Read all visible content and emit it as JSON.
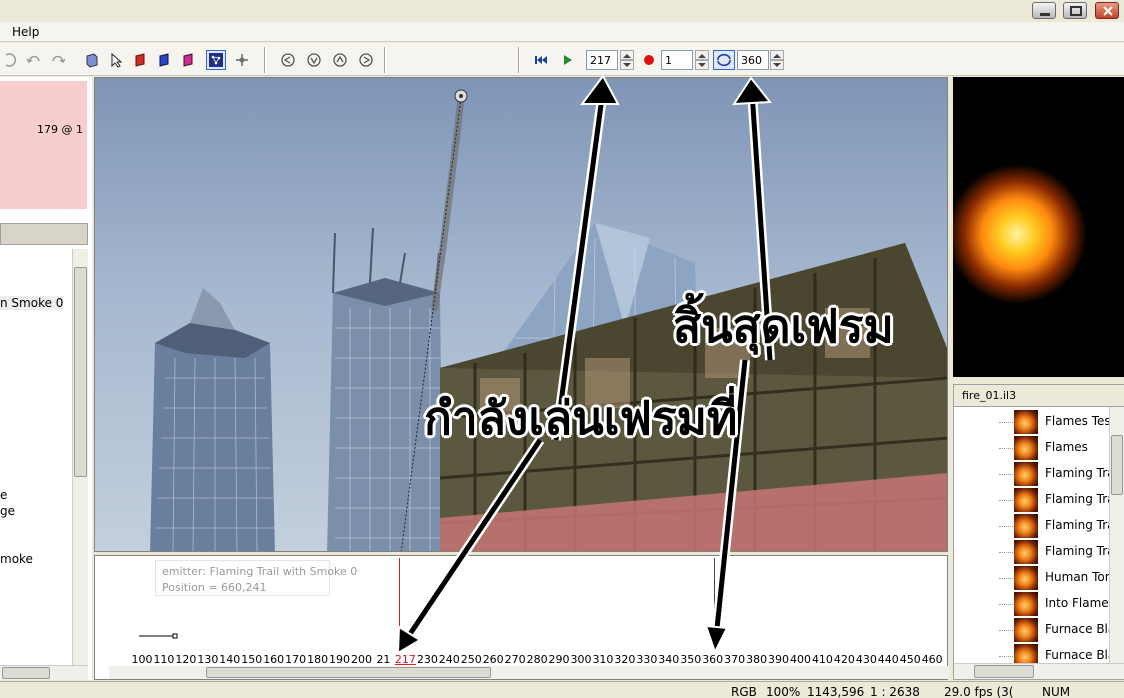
{
  "menu": {
    "help_label": "Help"
  },
  "toolbar": {
    "current_frame": "217",
    "frame_step": "1",
    "end_frame": "360"
  },
  "left_panel": {
    "pink_label": "179 @ 1",
    "items": [
      "n Smoke 0",
      "e",
      "ge",
      "moke"
    ]
  },
  "timeline": {
    "info_line1": "emitter:  Flaming Trail with Smoke 0",
    "info_line2": "Position = 660,241",
    "ticks": [
      "100",
      "110",
      "120",
      "130",
      "140",
      "150",
      "160",
      "170",
      "180",
      "190",
      "200",
      "21",
      "217",
      "230",
      "240",
      "250",
      "260",
      "270",
      "280",
      "290",
      "300",
      "310",
      "320",
      "330",
      "340",
      "350",
      "360",
      "370",
      "380",
      "390",
      "400",
      "410",
      "420",
      "430",
      "440",
      "450",
      "460"
    ],
    "current_tick": "217"
  },
  "effects_panel": {
    "title": "fire_01.il3",
    "items": [
      "Flames Tes",
      "Flames",
      "Flaming Tra",
      "Flaming Tra",
      "Flaming Tra",
      "Flaming Tra",
      "Human Tor",
      "Into Flames",
      "Furnace Bla",
      "Furnace Bla"
    ]
  },
  "status": {
    "color_mode": "RGB",
    "zoom": "100%",
    "coords": "1143,596",
    "ratio": "1 : 2638",
    "fps": "29.0 fps (3(",
    "num": "NUM"
  },
  "annotations": {
    "playing_frame": "กำลังเล่นเฟรมที่",
    "end_frame": "สิ้นสุดเฟรม"
  },
  "colors": {
    "viewport_sky": "#a6b8cf",
    "timeline_cursor": "#d02020",
    "preview_bg": "#000000",
    "pink_panel": "#f7cdcd"
  }
}
